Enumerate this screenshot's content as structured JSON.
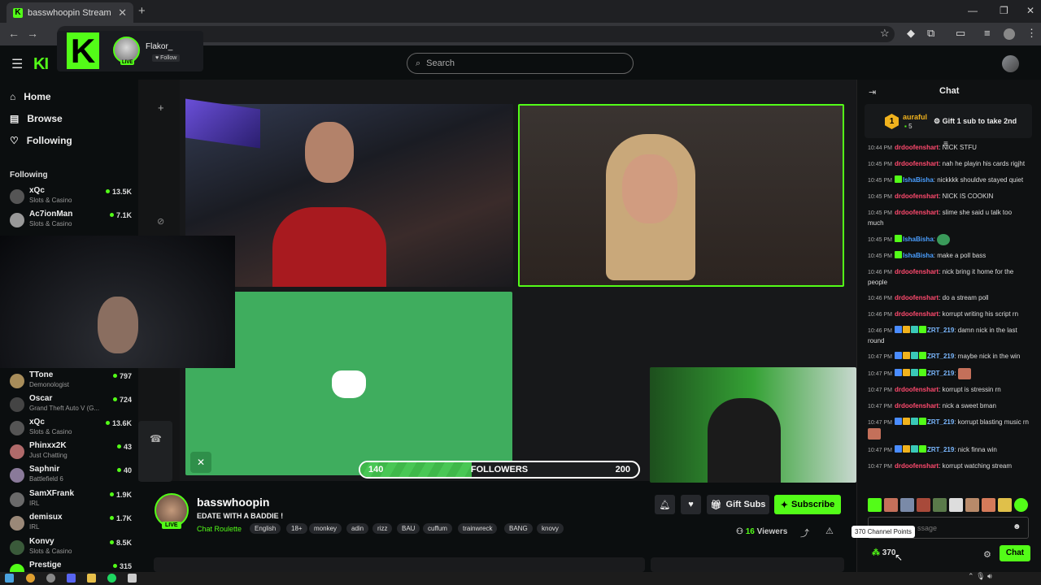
{
  "browser": {
    "tab_title": "basswhoopin Stream - Wat",
    "tab_close": "✕",
    "new_tab": "+",
    "window_controls": [
      "—",
      "❐",
      "✕"
    ]
  },
  "header": {
    "logo": "KI",
    "search_placeholder": "Search"
  },
  "popup": {
    "logo": "K",
    "name": "Flakor_",
    "follow_label": "♥ Follow",
    "live": "LIVE"
  },
  "sidebar": {
    "nav": [
      {
        "label": "Home",
        "icon": "home-icon"
      },
      {
        "label": "Browse",
        "icon": "browse-icon"
      },
      {
        "label": "Following",
        "icon": "heart-icon"
      }
    ],
    "following_heading": "Following",
    "channels_top": [
      {
        "name": "xQc",
        "game": "Slots & Casino",
        "viewers": "13.5K"
      },
      {
        "name": "Ac7ionMan",
        "game": "Slots & Casino",
        "viewers": "7.1K"
      }
    ],
    "channels_bottom": [
      {
        "name": "TTone",
        "game": "Demonologist",
        "viewers": "797"
      },
      {
        "name": "Oscar",
        "game": "Grand Theft Auto V (G...",
        "viewers": "724"
      },
      {
        "name": "xQc",
        "game": "Slots & Casino",
        "viewers": "13.6K"
      },
      {
        "name": "Phinxx2K",
        "game": "Just Chatting",
        "viewers": "43"
      },
      {
        "name": "Saphnir",
        "game": "Battlefield 6",
        "viewers": "40"
      },
      {
        "name": "SamXFrank",
        "game": "IRL",
        "viewers": "1.9K"
      },
      {
        "name": "demisux",
        "game": "IRL",
        "viewers": "1.7K"
      },
      {
        "name": "Konvy",
        "game": "Slots & Casino",
        "viewers": "8.5K"
      },
      {
        "name": "Prestige",
        "game": "",
        "viewers": "315"
      }
    ]
  },
  "player": {
    "follower_goal": {
      "current": "140",
      "label": "FOLLOWERS",
      "goal": "200",
      "progress": 0.4
    }
  },
  "stream": {
    "name": "basswhoopin",
    "title": "EDATE WITH A BADDIE !",
    "category": "Chat Roulette",
    "live": "LIVE",
    "tags": [
      "English",
      "18+",
      "monkey",
      "adin",
      "rizz",
      "BAU",
      "cuffum",
      "trainwreck",
      "BANG",
      "knovy"
    ],
    "gift_label": "Gift Subs",
    "subscribe_label": "Subscribe",
    "viewers_count": "16",
    "viewers_label": "Viewers"
  },
  "chat": {
    "title": "Chat",
    "pinned": {
      "rank": "1",
      "user": "auraful",
      "subs": "5",
      "text": "Gift 1 sub to take 2nd"
    },
    "messages": [
      {
        "time": "10:44 PM",
        "user": "drdoofenshart",
        "color": "#ff4a6e",
        "text": "NICK STFU"
      },
      {
        "time": "10:45 PM",
        "user": "drdoofenshart",
        "color": "#ff4a6e",
        "text": "nah he playin his cards rigjht"
      },
      {
        "time": "10:45 PM",
        "user": "IshaBisha",
        "color": "#4a9eff",
        "text": "nickkkk shouldve stayed quiet"
      },
      {
        "time": "10:45 PM",
        "user": "drdoofenshart",
        "color": "#ff4a6e",
        "text": "NICK IS COOKIN"
      },
      {
        "time": "10:45 PM",
        "user": "drdoofenshart",
        "color": "#ff4a6e",
        "text": "slime she said u talk too much"
      },
      {
        "time": "10:45 PM",
        "user": "IshaBisha",
        "color": "#4a9eff",
        "text": ""
      },
      {
        "time": "10:45 PM",
        "user": "IshaBisha",
        "color": "#4a9eff",
        "text": "make a poll bass"
      },
      {
        "time": "10:46 PM",
        "user": "drdoofenshart",
        "color": "#ff4a6e",
        "text": "nick bring it home for the people"
      },
      {
        "time": "10:46 PM",
        "user": "drdoofenshart",
        "color": "#ff4a6e",
        "text": "do a stream poll"
      },
      {
        "time": "10:46 PM",
        "user": "drdoofenshart",
        "color": "#ff4a6e",
        "text": "korrupt writing his script rn"
      },
      {
        "time": "10:46 PM",
        "user": "ZRT_219",
        "color": "#7ab8ff",
        "text": "damn nick in the last round"
      },
      {
        "time": "10:47 PM",
        "user": "ZRT_219",
        "color": "#7ab8ff",
        "text": "maybe nick in the win"
      },
      {
        "time": "10:47 PM",
        "user": "ZRT_219",
        "color": "#7ab8ff",
        "text": ""
      },
      {
        "time": "10:47 PM",
        "user": "drdoofenshart",
        "color": "#ff4a6e",
        "text": "korrupt is stressin rn"
      },
      {
        "time": "10:47 PM",
        "user": "drdoofenshart",
        "color": "#ff4a6e",
        "text": "nick a sweet bman"
      },
      {
        "time": "10:47 PM",
        "user": "ZRT_219",
        "color": "#7ab8ff",
        "text": "korrupt blasting music rn"
      },
      {
        "time": "10:47 PM",
        "user": "ZRT_219",
        "color": "#7ab8ff",
        "text": "nick finna win"
      },
      {
        "time": "10:47 PM",
        "user": "drdoofenshart",
        "color": "#ff4a6e",
        "text": "korrupt watching stream"
      }
    ],
    "input_placeholder": "ssage",
    "tooltip": "370 Channel Points",
    "points": "370",
    "send_label": "Chat"
  },
  "colors": {
    "accent": "#53fc18",
    "bg": "#0b0e0f"
  }
}
